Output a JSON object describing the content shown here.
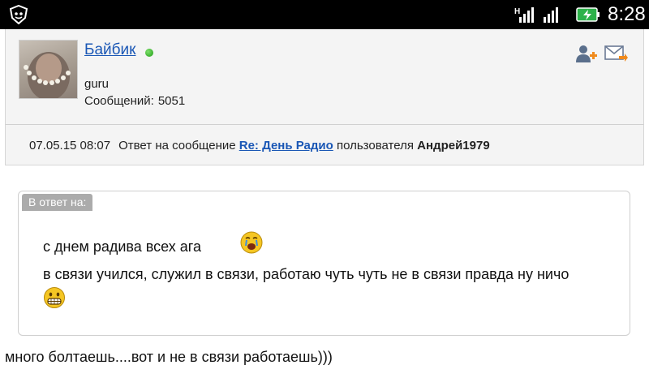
{
  "status_bar": {
    "network_label": "H",
    "time": "8:28",
    "icons": [
      "app-shield-icon",
      "signal-icon",
      "battery-charging-icon"
    ]
  },
  "profile": {
    "username": "Байбик",
    "online_status": "online",
    "rank": "guru",
    "posts_label": "Сообщений:",
    "posts_count": "5051",
    "actions": [
      "add-friend-icon",
      "send-message-icon"
    ]
  },
  "meta": {
    "date": "07.05.15 08:07",
    "reply_prefix": "Ответ на сообщение",
    "thread_link": "Re: День Радио",
    "by_user_prefix": "пользователя",
    "original_author": "Андрей1979"
  },
  "quote": {
    "label": "В ответ на:",
    "line1": "с днем радива всех ага",
    "line2": "в связи учился, служил в связи, работаю чуть чуть не в связи правда ну ничо",
    "smileys": [
      "crying-smiley-icon",
      "grinning-smiley-icon"
    ]
  },
  "reply_text": "много болтаешь....вот и не в связи работаешь)))",
  "colors": {
    "link": "#1a57b5",
    "header_bg": "#f4f4f4",
    "quote_label_bg": "#ababab",
    "online": "#1f9c14"
  }
}
